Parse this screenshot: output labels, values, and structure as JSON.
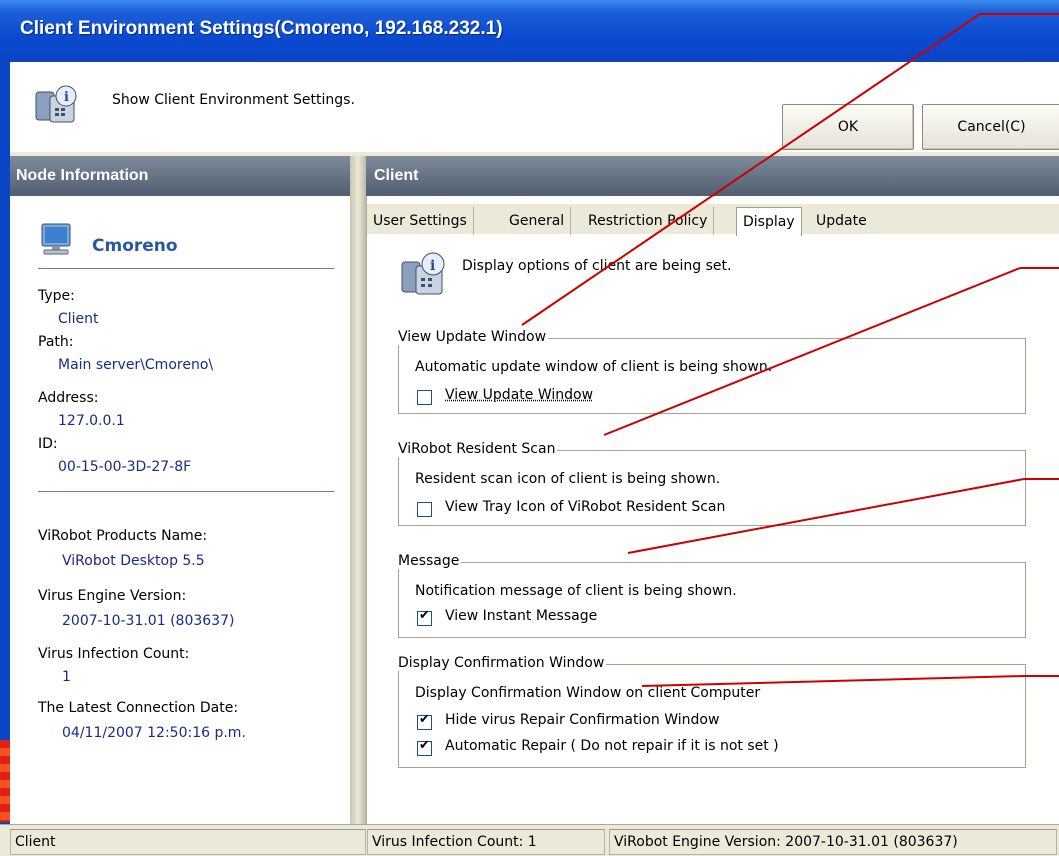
{
  "window": {
    "title": "Client Environment Settings(Cmoreno, 192.168.232.1)",
    "header_text": "Show Client Environment Settings.",
    "ok_label": "OK",
    "cancel_label": "Cancel(C)"
  },
  "left": {
    "header": "Node Information",
    "node_name": "Cmoreno",
    "fields": [
      {
        "label": "Type:",
        "value": "Client"
      },
      {
        "label": "Path:",
        "value": "Main server\\Cmoreno\\"
      },
      {
        "label": "Address:",
        "value": "127.0.0.1"
      },
      {
        "label": "ID:",
        "value": "00-15-00-3D-27-8F"
      }
    ],
    "info": [
      {
        "label": "ViRobot Products Name:",
        "value": "ViRobot Desktop 5.5"
      },
      {
        "label": "Virus Engine Version:",
        "value": "2007-10-31.01 (803637)"
      },
      {
        "label": "Virus Infection Count:",
        "value": "1"
      },
      {
        "label": "The Latest Connection Date:",
        "value": "04/11/2007 12:50:16 p.m."
      }
    ]
  },
  "right": {
    "header": "Client",
    "tabs": [
      {
        "label": "User Settings",
        "active": false
      },
      {
        "label": "General",
        "active": false
      },
      {
        "label": "Restriction Policy",
        "active": false
      },
      {
        "label": "Display",
        "active": true
      },
      {
        "label": "Update",
        "active": false
      }
    ],
    "description": "Display options of client are being set.",
    "groups": [
      {
        "title": "View Update Window",
        "desc": "Automatic update window of client is being shown.",
        "options": [
          {
            "label": "View Update Window",
            "checked": false
          }
        ]
      },
      {
        "title": "ViRobot Resident Scan",
        "desc": "Resident scan icon of client is being shown.",
        "options": [
          {
            "label": "View Tray Icon of ViRobot Resident Scan",
            "checked": false
          }
        ]
      },
      {
        "title": "Message",
        "desc": "Notification message of client is being shown.",
        "options": [
          {
            "label": "View Instant Message",
            "checked": true
          }
        ]
      },
      {
        "title": "Display Confirmation Window",
        "desc": "Display Confirmation Window on client Computer",
        "options": [
          {
            "label": "Hide virus Repair Confirmation Window",
            "checked": true
          },
          {
            "label": "Automatic Repair ( Do not repair if it is not set )",
            "checked": true
          }
        ]
      }
    ]
  },
  "status": {
    "left": "Client",
    "middle": "Virus Infection Count: 1",
    "right": "ViRobot Engine Version: 2007-10-31.01 (803637)"
  },
  "colors": {
    "title_bar": "#0b44c4",
    "panel_header": "#5c6a7d",
    "annotation_line": "#cc0000",
    "node_name": "#2b56a0"
  },
  "icons": [
    "settings-info-icon",
    "computer-icon",
    "checkbox-check-icon"
  ]
}
